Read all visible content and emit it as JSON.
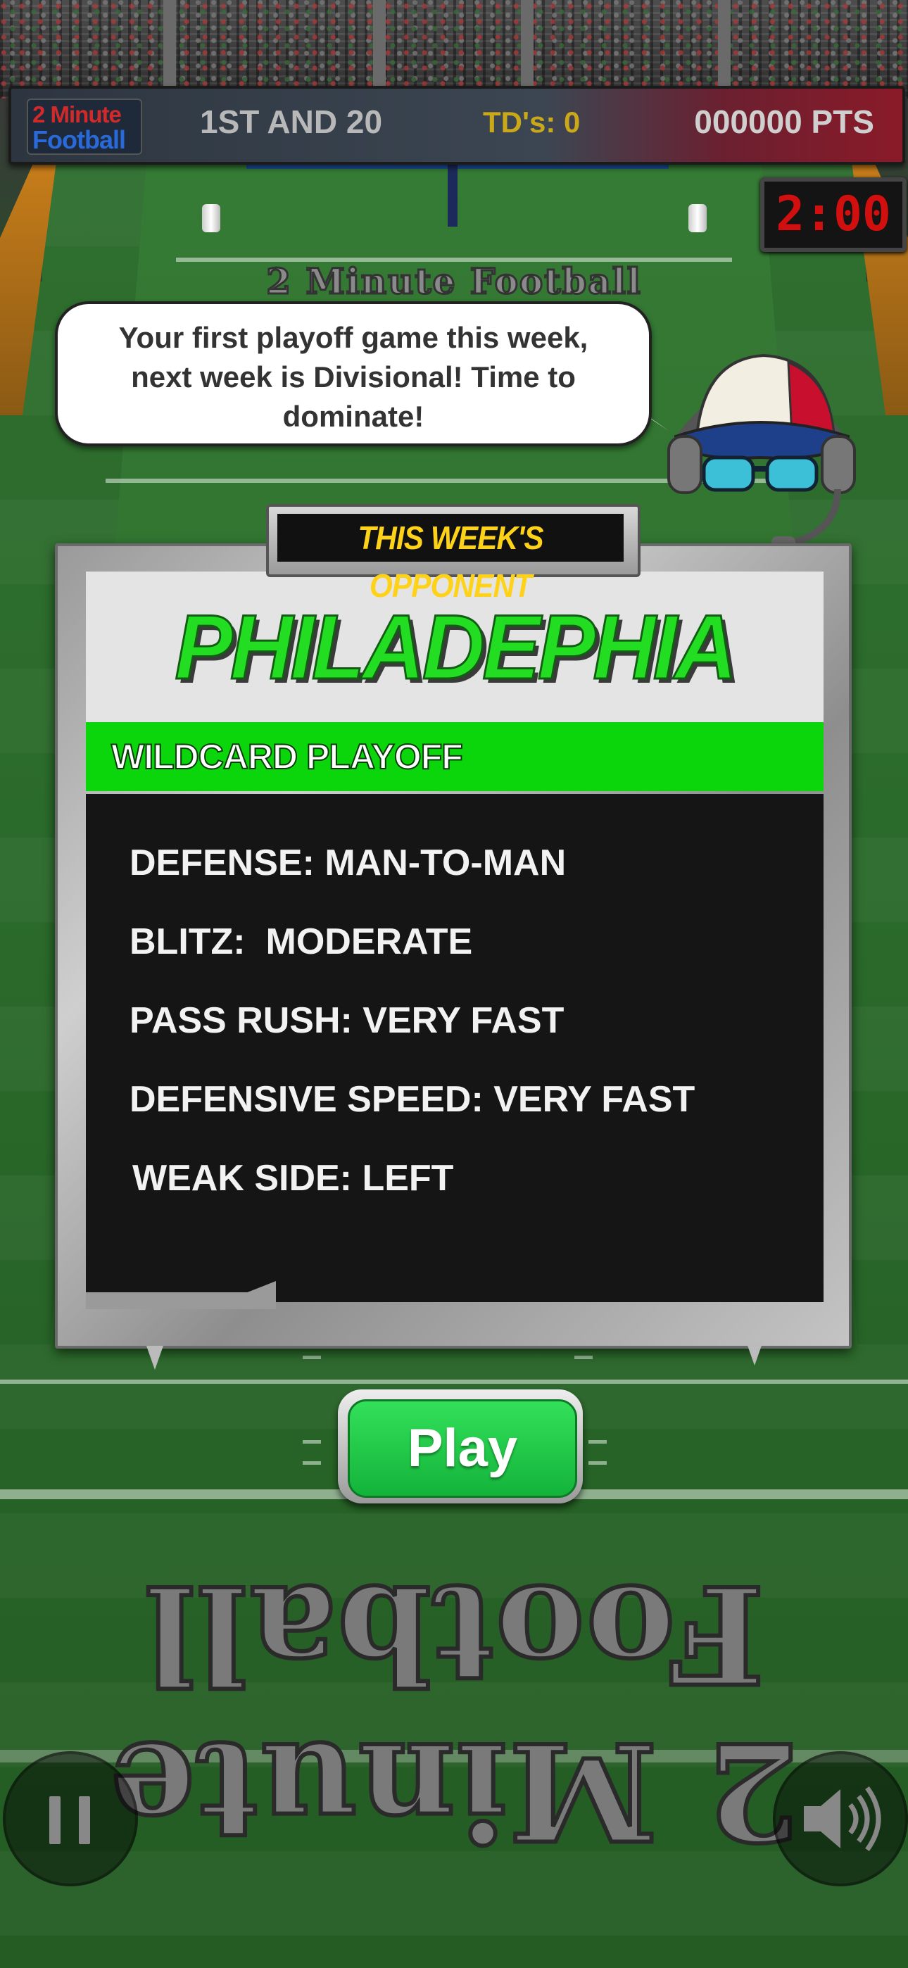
{
  "hud": {
    "logo_line1": "2 Minute",
    "logo_line2": "Football",
    "down": "1ST AND 20",
    "tds": "TD's: 0",
    "points": "000000 PTS"
  },
  "clock": "2:00",
  "field": {
    "endzone_top": "2 Minute Football",
    "endzone_bottom": "2 Minute Football"
  },
  "coach": {
    "speech": "Your first playoff game this week, next week is Divisional! Time to dominate!",
    "icon": "coach-icon"
  },
  "panel": {
    "tab_label": "THIS WEEK'S OPPONENT",
    "team": "PHILADEPHIA",
    "round": "WILDCARD PLAYOFF",
    "stats": [
      "DEFENSE: MAN-TO-MAN",
      "BLITZ:  MODERATE",
      "PASS RUSH: VERY FAST",
      "DEFENSIVE SPEED: VERY FAST",
      "WEAK SIDE: LEFT"
    ]
  },
  "buttons": {
    "play": "Play",
    "pause_icon": "pause-icon",
    "sound_icon": "speaker-icon"
  },
  "colors": {
    "accent_green": "#0bd60b",
    "team_green": "#22dd22",
    "tab_yellow": "#ffd21a",
    "clock_red": "#d10f0f"
  }
}
